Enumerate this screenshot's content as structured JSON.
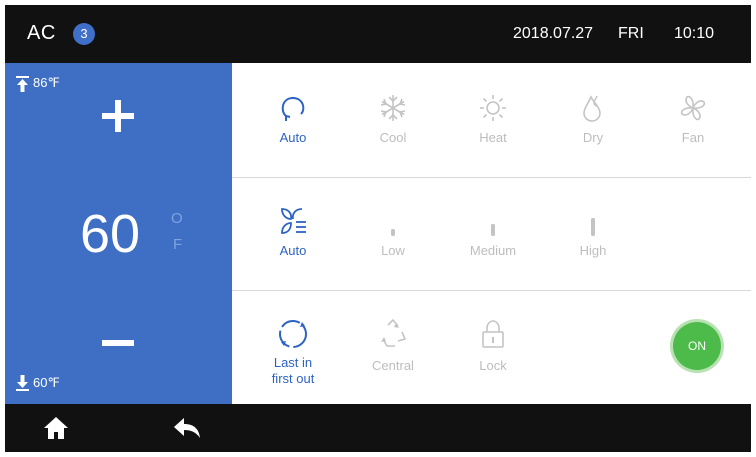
{
  "header": {
    "title": "AC",
    "badge": "3",
    "date": "2018.07.27",
    "day": "FRI",
    "time": "10:10"
  },
  "temperature": {
    "max": "86℉",
    "min": "60℉",
    "value": "60",
    "unit_o": "O",
    "unit_f": "F"
  },
  "modes": [
    {
      "label": "Auto",
      "icon": "auto-mode-icon",
      "active": true
    },
    {
      "label": "Cool",
      "icon": "snowflake-icon",
      "active": false
    },
    {
      "label": "Heat",
      "icon": "sun-icon",
      "active": false
    },
    {
      "label": "Dry",
      "icon": "droplet-icon",
      "active": false
    },
    {
      "label": "Fan",
      "icon": "fan-icon",
      "active": false
    }
  ],
  "fan_speeds": [
    {
      "label": "Auto",
      "icon": "fan-auto-icon",
      "active": true
    },
    {
      "label": "Low",
      "icon": "speed-low-icon",
      "active": false
    },
    {
      "label": "Medium",
      "icon": "speed-medium-icon",
      "active": false
    },
    {
      "label": "High",
      "icon": "speed-high-icon",
      "active": false
    }
  ],
  "controls": [
    {
      "label_line1": "Last in",
      "label_line2": "first out",
      "icon": "rotate-icon",
      "active": true
    },
    {
      "label": "Central",
      "icon": "recycle-icon",
      "active": false
    },
    {
      "label": "Lock",
      "icon": "lock-icon",
      "active": false
    }
  ],
  "power": {
    "label": "ON",
    "state": "on"
  },
  "colors": {
    "accent": "#2d63c4",
    "panel": "#3e6fc4",
    "power_on": "#4dbb4a",
    "inactive": "#bdbdbd",
    "bar": "#111111"
  }
}
